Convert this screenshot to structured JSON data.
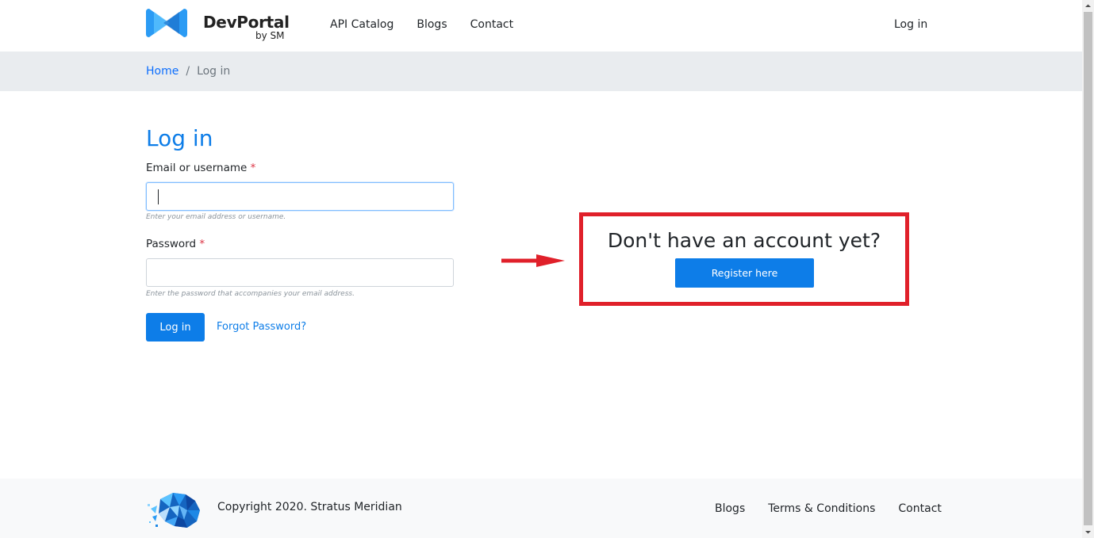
{
  "brand": {
    "title": "DevPortal",
    "subtitle": "by SM",
    "colors": {
      "accent": "#0d7de8",
      "logo_light": "#5cc3ff",
      "logo_dark": "#1565c0"
    }
  },
  "nav": {
    "items": [
      {
        "label": "API Catalog"
      },
      {
        "label": "Blogs"
      },
      {
        "label": "Contact"
      }
    ],
    "login_label": "Log in"
  },
  "breadcrumb": {
    "home": "Home",
    "separator": "/",
    "current": "Log in"
  },
  "login_form": {
    "title": "Log in",
    "email": {
      "label": "Email or username",
      "required_mark": "*",
      "value": "",
      "help": "Enter your email address or username."
    },
    "password": {
      "label": "Password",
      "required_mark": "*",
      "value": "",
      "help": "Enter the password that accompanies your email address."
    },
    "submit_label": "Log in",
    "forgot_label": "Forgot Password?"
  },
  "register": {
    "heading": "Don't have an account yet?",
    "button_label": "Register here",
    "highlight_color": "#e0202a"
  },
  "footer": {
    "copyright": "Copyright 2020. Stratus Meridian",
    "links": [
      {
        "label": "Blogs"
      },
      {
        "label": "Terms & Conditions"
      },
      {
        "label": "Contact"
      }
    ]
  }
}
